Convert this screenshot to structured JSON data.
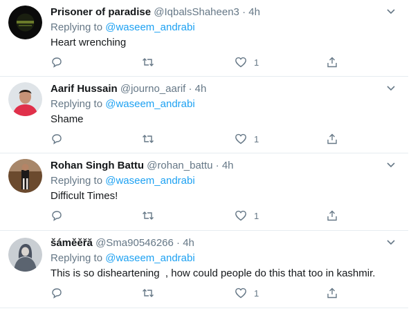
{
  "tweets": [
    {
      "name": "Prisoner of paradise",
      "handle": "@IqbalsShaheen3",
      "time": "4h",
      "reply_prefix": "Replying to",
      "reply_to": "@waseem_andrabi",
      "text": "Heart wrenching",
      "like_count": "1"
    },
    {
      "name": "Aarif Hussain",
      "handle": "@journo_aarif",
      "time": "4h",
      "reply_prefix": "Replying to",
      "reply_to": "@waseem_andrabi",
      "text": "Shame",
      "like_count": "1"
    },
    {
      "name": "Rohan Singh Battu",
      "handle": "@rohan_battu",
      "time": "4h",
      "reply_prefix": "Replying to",
      "reply_to": "@waseem_andrabi",
      "text": "Difficult Times!",
      "like_count": "1"
    },
    {
      "name": "šáměěřă",
      "handle": "@Sma90546266",
      "time": "4h",
      "reply_prefix": "Replying to",
      "reply_to": "@waseem_andrabi",
      "text": "This is so disheartening  , how could people do this that too in kashmir.",
      "like_count": "1"
    }
  ],
  "icons": {
    "reply": "reply-icon",
    "retweet": "retweet-icon",
    "like": "heart-icon",
    "share": "share-icon",
    "menu": "chevron-down-icon"
  },
  "colors": {
    "accent": "#1da1f2",
    "muted": "#657786",
    "text": "#14171a",
    "divider": "#e6ecf0"
  }
}
